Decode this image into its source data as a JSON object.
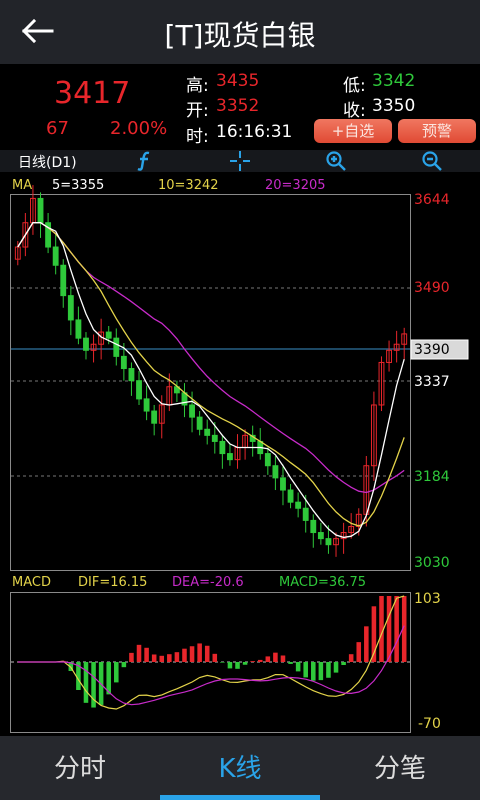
{
  "header": {
    "title": "[T]现货白银"
  },
  "quote": {
    "price": "3417",
    "change": "67",
    "change_pct": "2.00%",
    "high_label": "高:",
    "high": "3435",
    "low_label": "低:",
    "low": "3342",
    "open_label": "开:",
    "open": "3352",
    "close_label": "收:",
    "close": "3350",
    "time_label": "时:",
    "time": "16:16:31",
    "add_watch_label": "+自选",
    "alert_label": "预警"
  },
  "toolbar": {
    "period_label": "日线(D1)"
  },
  "ma": {
    "title": "MA",
    "ma5": "5=3355",
    "ma10": "10=3242",
    "ma20": "20=3205"
  },
  "price_axis": {
    "top": "3644",
    "upper": "3490",
    "current": "3390",
    "mid": "3337",
    "lower": "3184",
    "bottom": "3030"
  },
  "macd": {
    "title": "MACD",
    "dif": "DIF=16.15",
    "dea": "DEA=-20.6",
    "macd": "MACD=36.75",
    "axis_top": "103",
    "axis_bottom": "-70"
  },
  "nav": {
    "tabs": [
      {
        "label": "分时"
      },
      {
        "label": "K线"
      },
      {
        "label": "分笔"
      }
    ]
  },
  "colors": {
    "up": "#e8262b",
    "down": "#2fc93b",
    "ma5": "#ffffff",
    "ma10": "#e3d34a",
    "ma20": "#c72bc9",
    "accent": "#2aa3e8"
  }
}
